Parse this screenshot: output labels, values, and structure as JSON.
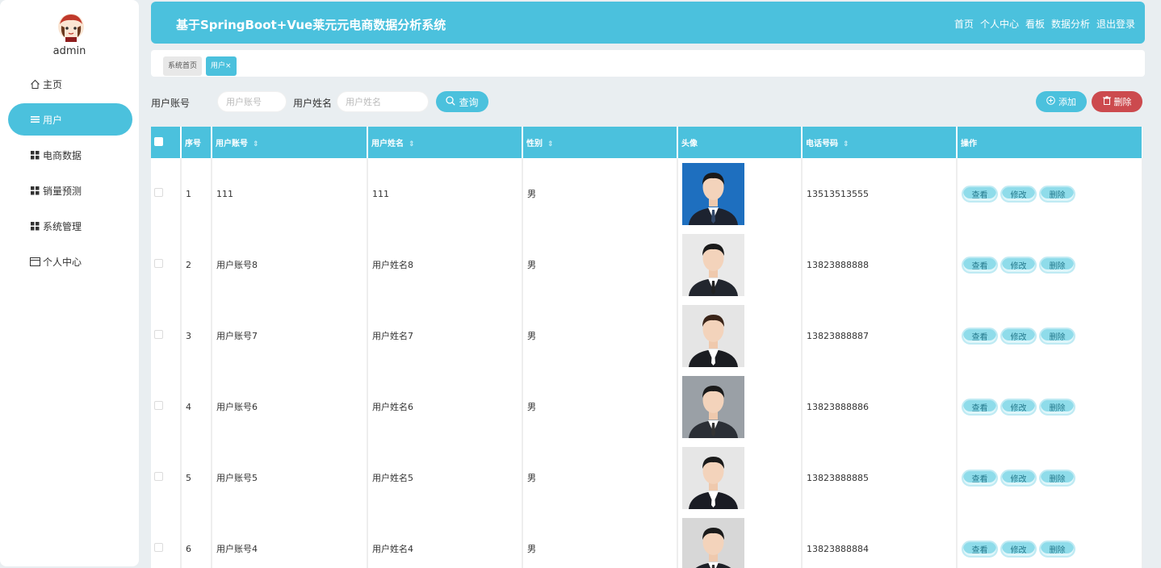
{
  "sidebar": {
    "username": "admin",
    "items": [
      {
        "label": "主页",
        "icon": "home-icon"
      },
      {
        "label": "用户",
        "icon": "list-icon"
      },
      {
        "label": "电商数据",
        "icon": "grid-icon"
      },
      {
        "label": "销量预测",
        "icon": "grid-icon"
      },
      {
        "label": "系统管理",
        "icon": "grid-icon"
      },
      {
        "label": "个人中心",
        "icon": "card-icon"
      }
    ]
  },
  "header": {
    "title": "基于SpringBoot+Vue莱元元电商数据分析系统",
    "nav": [
      "首页",
      "个人中心",
      "看板",
      "数据分析",
      "退出登录"
    ]
  },
  "tabs": {
    "home": "系统首页",
    "user": "用户×"
  },
  "search": {
    "account_label": "用户账号",
    "account_placeholder": "用户账号",
    "name_label": "用户姓名",
    "name_placeholder": "用户姓名",
    "query_button": "查询",
    "add_button": "添加",
    "delete_button": "删除"
  },
  "table": {
    "headers": [
      "序号",
      "用户账号",
      "用户姓名",
      "性别",
      "头像",
      "电话号码",
      "操作"
    ],
    "actions": [
      "查看",
      "修改",
      "删除"
    ],
    "rows": [
      {
        "no": "1",
        "account": "111",
        "name": "111",
        "gender": "男",
        "phone": "13513513555"
      },
      {
        "no": "2",
        "account": "用户账号8",
        "name": "用户姓名8",
        "gender": "男",
        "phone": "13823888888"
      },
      {
        "no": "3",
        "account": "用户账号7",
        "name": "用户姓名7",
        "gender": "男",
        "phone": "13823888887"
      },
      {
        "no": "4",
        "account": "用户账号6",
        "name": "用户姓名6",
        "gender": "男",
        "phone": "13823888886"
      },
      {
        "no": "5",
        "account": "用户账号5",
        "name": "用户姓名5",
        "gender": "男",
        "phone": "13823888885"
      },
      {
        "no": "6",
        "account": "用户账号4",
        "name": "用户姓名4",
        "gender": "男",
        "phone": "13823888884"
      }
    ]
  },
  "colors": {
    "accent": "#4bc1dd",
    "danger": "#cc4a4e",
    "background": "#e9eef1"
  }
}
